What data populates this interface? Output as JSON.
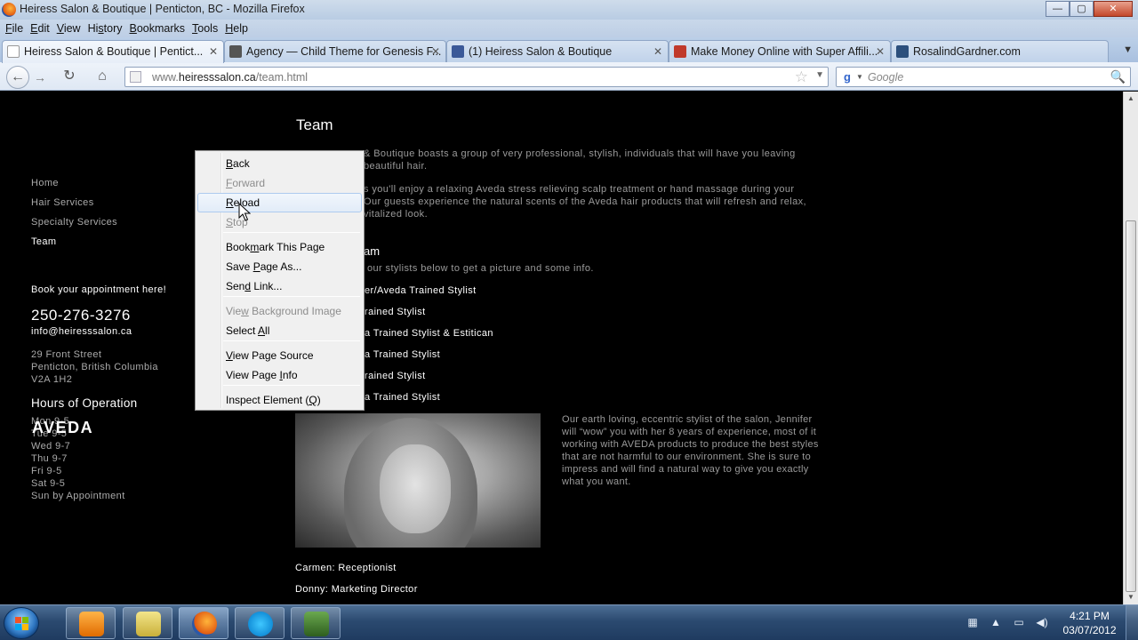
{
  "window": {
    "title": "Heiress Salon & Boutique  |  Penticton, BC - Mozilla Firefox",
    "buttons": {
      "minimize": "—",
      "maximize": "▢",
      "close": "✕"
    }
  },
  "menubar": {
    "items": [
      {
        "u": "F",
        "rest": "ile"
      },
      {
        "u": "E",
        "rest": "dit"
      },
      {
        "u": "V",
        "rest": "iew"
      },
      {
        "u": "",
        "rest": "Hi",
        "u2": "s",
        "rest2": "tory"
      },
      {
        "u": "B",
        "rest": "ookmarks"
      },
      {
        "u": "T",
        "rest": "ools"
      },
      {
        "u": "H",
        "rest": "elp"
      }
    ]
  },
  "tabs": [
    {
      "label": "Heiress Salon & Boutique  |  Pentict...",
      "active": true,
      "favicon_color": "#ffffff"
    },
    {
      "label": "Agency — Child Theme for Genesis F...",
      "active": false,
      "favicon_color": "#555555"
    },
    {
      "label": "(1) Heiress Salon & Boutique",
      "active": false,
      "favicon_color": "#3b5998"
    },
    {
      "label": "Make Money Online with Super Affili...",
      "active": false,
      "favicon_color": "#c0392b"
    },
    {
      "label": "RosalindGardner.com",
      "active": false,
      "favicon_color": "#2c4f7c"
    }
  ],
  "nav": {
    "url_prefix": "www.",
    "url_domain": "heiresssalon.ca",
    "url_path": "/team.html",
    "search_placeholder": "Google"
  },
  "sidebar": {
    "nav": [
      "Home",
      "Hair Services",
      "Specialty Services",
      "Team"
    ],
    "book_label": "Book your appointment here!",
    "phone": "250-276-3276",
    "email": "info@heiresssalon.ca",
    "address": [
      "29 Front Street",
      "Penticton, British Columbia",
      "V2A 1H2"
    ],
    "hours_title": "Hours of Operation",
    "hours": [
      "Mon 9-5",
      "Tue 9-5",
      "Wed 9-7",
      "Thu 9-7",
      "Fri 9-5",
      "Sat 9-5",
      "Sun by Appointment"
    ],
    "brand_logo": "AVEDA"
  },
  "main": {
    "title": "Team",
    "intro_1": [
      "& Boutique boasts a group of very professional, stylish, individuals that will have you leaving",
      "beautiful hair."
    ],
    "intro_2": [
      "s you'll enjoy a relaxing Aveda stress relieving scalp treatment or hand massage during your",
      "Our guests experience the natural scents of the Aveda hair products that will refresh and relax,",
      "vitalized look."
    ],
    "team_heading": "am",
    "team_sub": "our stylists below to get a picture and some info.",
    "stylists": [
      "er/Aveda Trained Stylist",
      "rained Stylist",
      "a Trained Stylist & Estitican",
      "a Trained Stylist",
      "rained Stylist",
      "a Trained Stylist"
    ],
    "bio": "Our earth loving, eccentric stylist of the salon, Jennifer will “wow” you with her 8 years of experience, most of it working with AVEDA products to produce the best styles that are not harmful to our environment. She is sure to impress and will find a natural way to give you exactly what you want.",
    "staff": [
      "Carmen: Receptionist",
      "Donny: Marketing Director"
    ]
  },
  "context_menu": {
    "items": [
      {
        "pre": "",
        "u": "B",
        "post": "ack",
        "state": "enabled"
      },
      {
        "pre": "",
        "u": "F",
        "post": "orward",
        "state": "disabled"
      },
      {
        "pre": "",
        "u": "R",
        "post": "eload",
        "state": "hover"
      },
      {
        "pre": "",
        "u": "S",
        "post": "top",
        "state": "disabled"
      },
      {
        "pre": "Book",
        "u": "m",
        "post": "ark This Page",
        "state": "enabled"
      },
      {
        "pre": "Save ",
        "u": "P",
        "post": "age As...",
        "state": "enabled"
      },
      {
        "pre": "Sen",
        "u": "d",
        "post": " Link...",
        "state": "enabled"
      },
      {
        "pre": "Vie",
        "u": "w",
        "post": " Background Image",
        "state": "disabled"
      },
      {
        "pre": "Select ",
        "u": "A",
        "post": "ll",
        "state": "enabled"
      },
      {
        "pre": "",
        "u": "V",
        "post": "iew Page Source",
        "state": "enabled"
      },
      {
        "pre": "View Page ",
        "u": "I",
        "post": "nfo",
        "state": "enabled"
      },
      {
        "pre": "Inspect Element (",
        "u": "Q",
        "post": ")",
        "state": "enabled"
      }
    ]
  },
  "taskbar": {
    "apps": [
      "media-player-icon",
      "folder-icon",
      "firefox-icon",
      "skype-icon",
      "camtasia-icon"
    ],
    "clock_time": "4:21 PM",
    "clock_date": "03/07/2012"
  },
  "colors": {
    "page_bg": "#000000",
    "text_grey": "#9a9a9a",
    "menu_hover": "#e2ecf8"
  }
}
